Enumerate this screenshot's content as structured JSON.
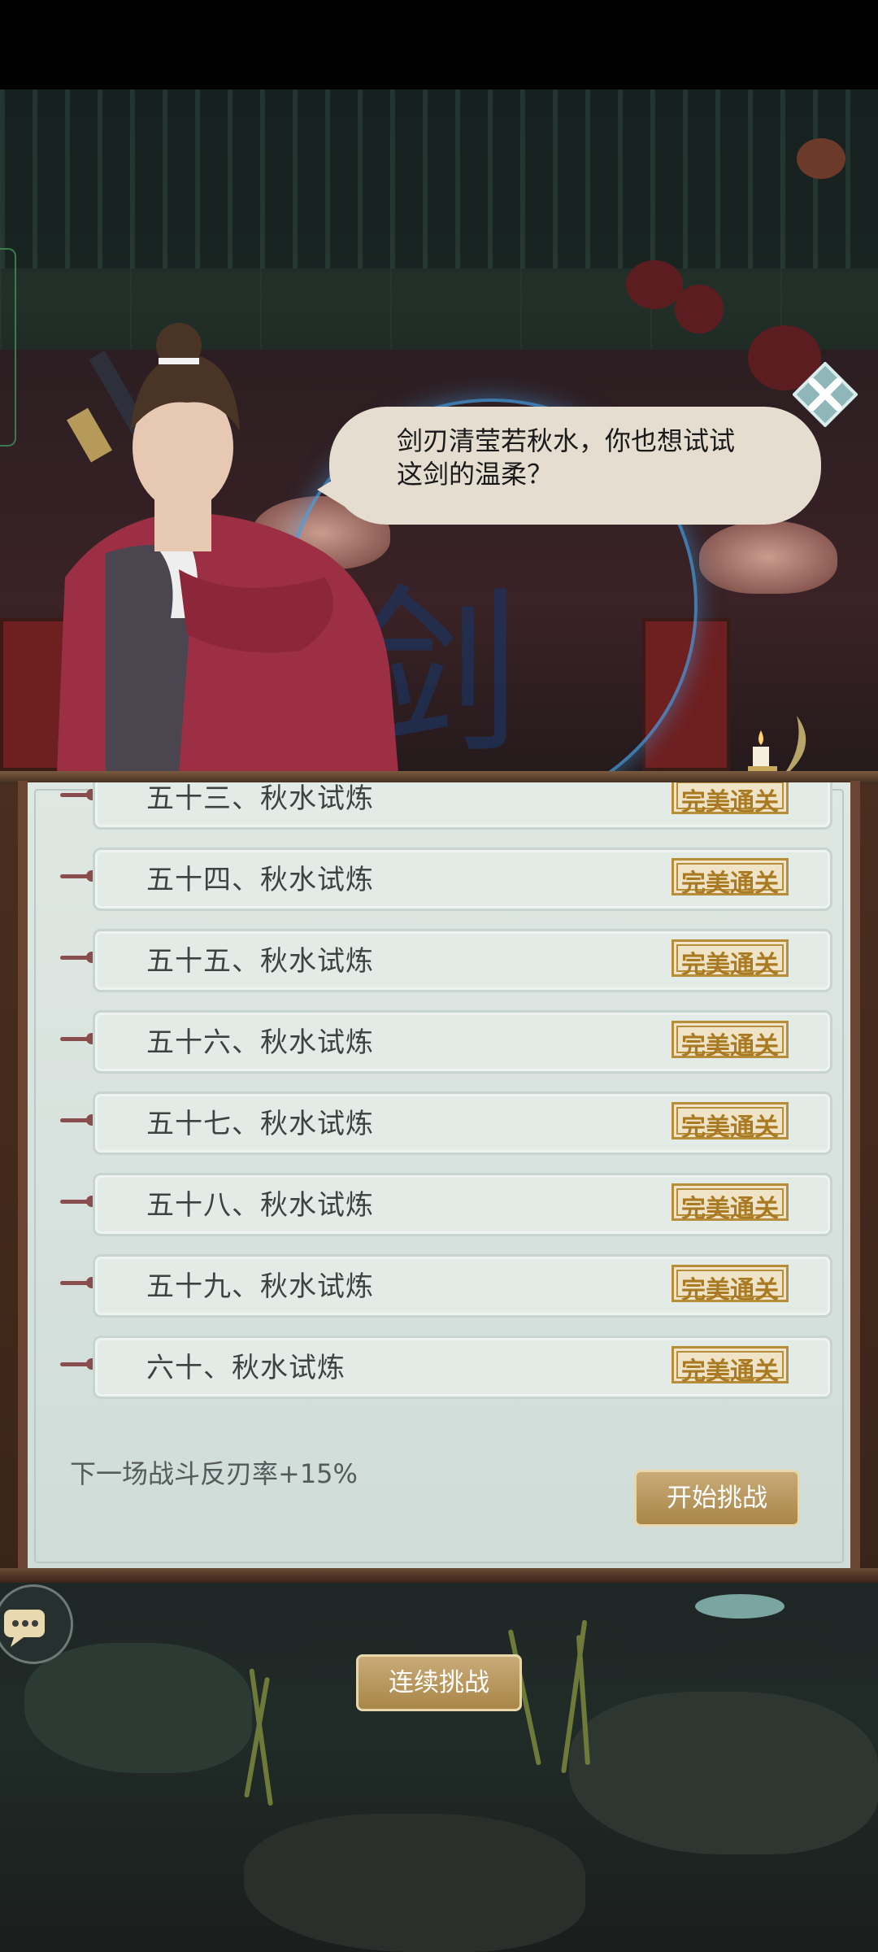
{
  "dialogue": {
    "text_line1": "剑刃清莹若秋水，你也想试试",
    "text_line2": "这剑的温柔？"
  },
  "emblem_char": "剑",
  "stages": [
    {
      "label": "五十三、秋水试炼",
      "status": "完美通关"
    },
    {
      "label": "五十四、秋水试炼",
      "status": "完美通关"
    },
    {
      "label": "五十五、秋水试炼",
      "status": "完美通关"
    },
    {
      "label": "五十六、秋水试炼",
      "status": "完美通关"
    },
    {
      "label": "五十七、秋水试炼",
      "status": "完美通关"
    },
    {
      "label": "五十八、秋水试炼",
      "status": "完美通关"
    },
    {
      "label": "五十九、秋水试炼",
      "status": "完美通关"
    },
    {
      "label": "六十、秋水试炼",
      "status": "完美通关"
    }
  ],
  "bonus_text": "下一场战斗反刃率+15%",
  "buttons": {
    "start": "开始挑战",
    "continuous": "连续挑战"
  },
  "colors": {
    "accent_gold": "#a98648",
    "badge_gold": "#b78d3a",
    "panel_bg": "#dfe7e2",
    "speech_bg": "#e4ddd0"
  },
  "icons": {
    "close": "close-x-icon",
    "chat": "chat-bubble-icon"
  }
}
